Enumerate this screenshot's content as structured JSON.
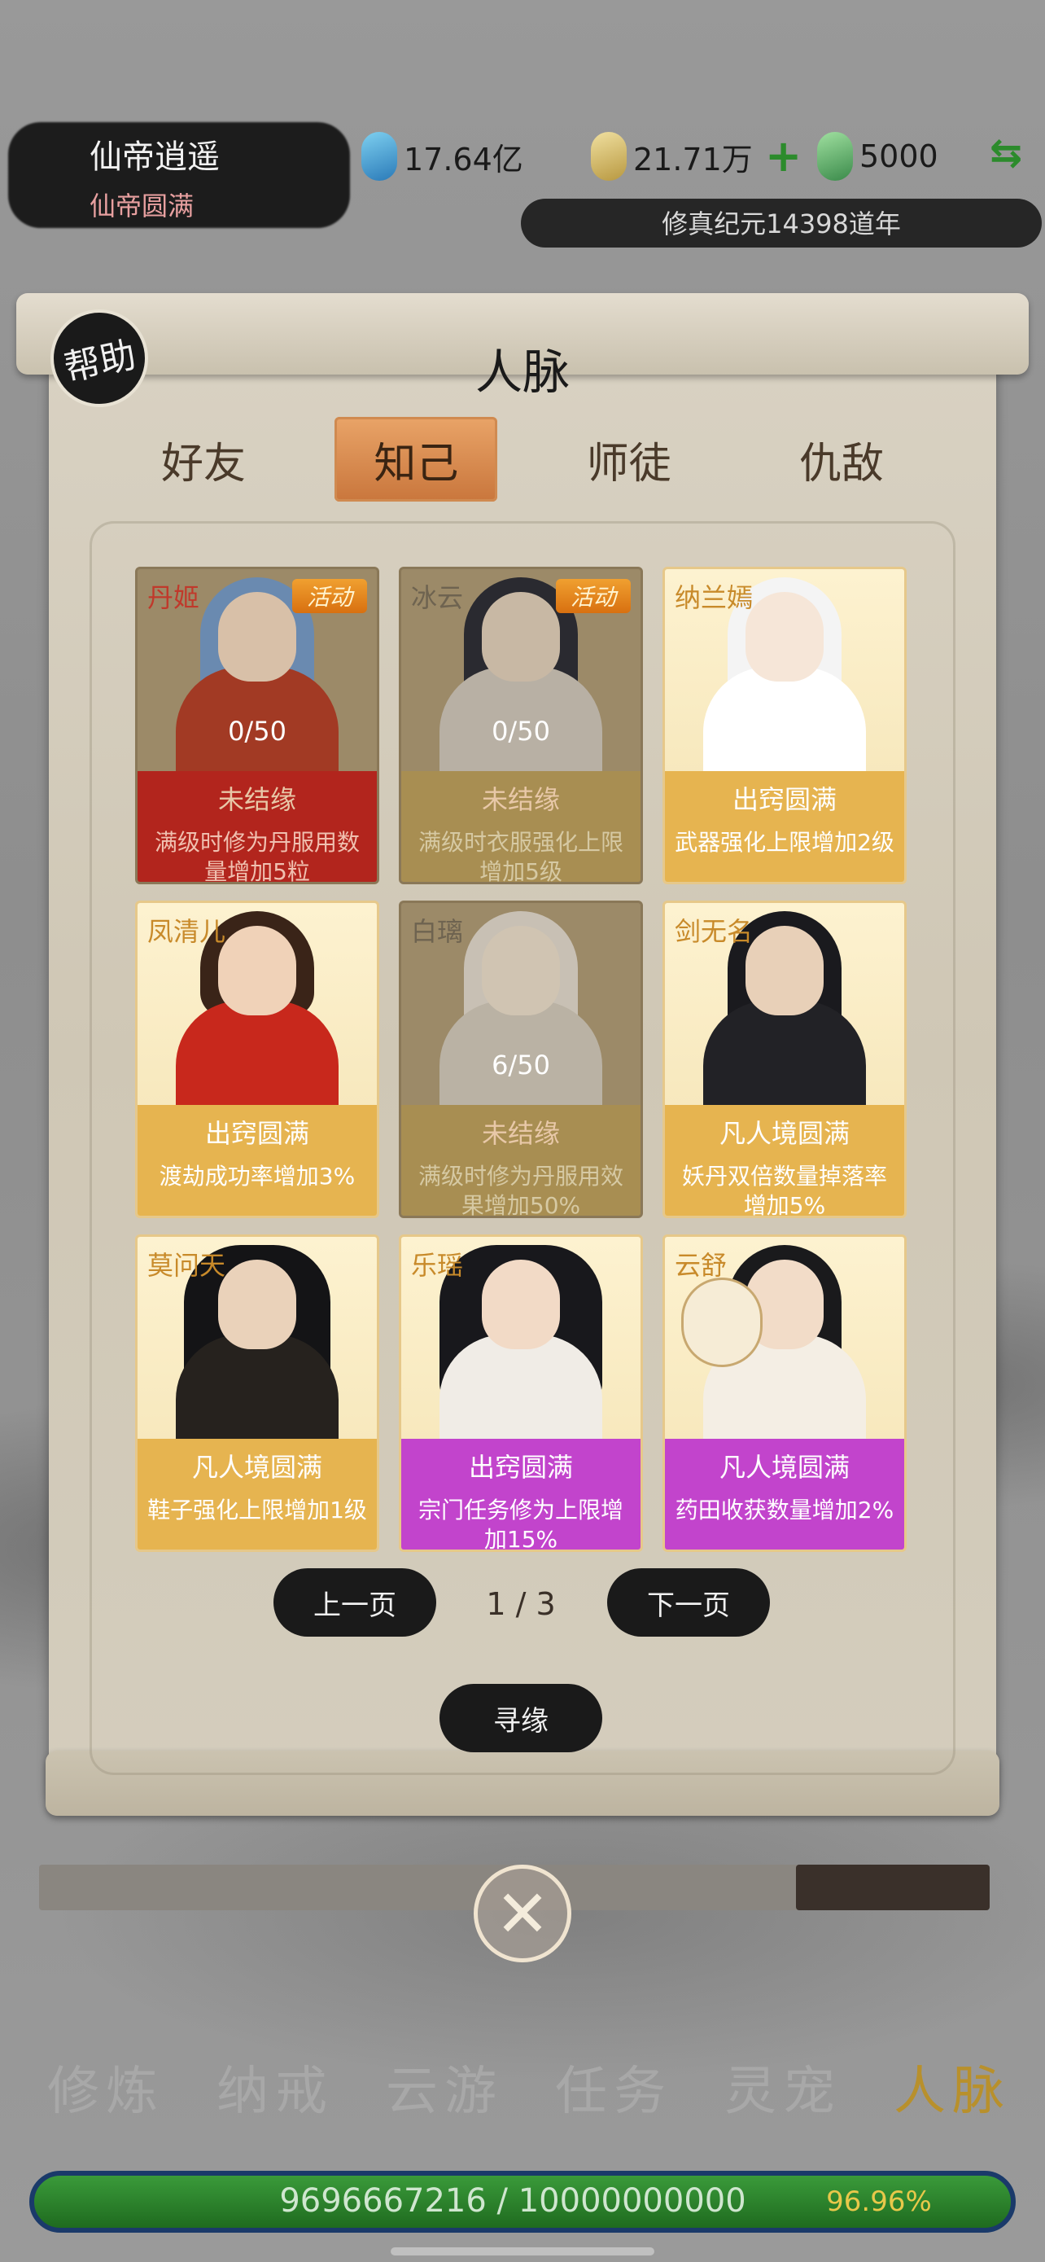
{
  "player": {
    "name": "仙帝逍遥",
    "rank": "仙帝圆满"
  },
  "resources": {
    "spirit_stone": "17.64亿",
    "gold": "21.71万",
    "jade": "5000",
    "plus": "+",
    "swap": "⇆"
  },
  "era": "修真纪元14398道年",
  "help_label": "帮助",
  "panel_title": "人脉",
  "tabs": [
    {
      "label": "好友",
      "active": false
    },
    {
      "label": "知己",
      "active": true
    },
    {
      "label": "师徒",
      "active": false
    },
    {
      "label": "仇敌",
      "active": false
    }
  ],
  "cards": [
    {
      "name": "丹姬",
      "badge": "活动",
      "progress": "0/50",
      "status": "未结缘",
      "effect": "满级时修为丹服用数量增加5粒",
      "style": "red",
      "locked": true
    },
    {
      "name": "冰云",
      "badge": "活动",
      "progress": "0/50",
      "status": "未结缘",
      "effect": "满级时衣服强化上限增加5级",
      "style": "dim",
      "locked": true
    },
    {
      "name": "纳兰嫣",
      "badge": "",
      "progress": "",
      "status": "出窍圆满",
      "effect": "武器强化上限增加2级",
      "style": "gold",
      "locked": false
    },
    {
      "name": "凤清儿",
      "badge": "",
      "progress": "",
      "status": "出窍圆满",
      "effect": "渡劫成功率增加3%",
      "style": "gold",
      "locked": false
    },
    {
      "name": "白璃",
      "badge": "",
      "progress": "6/50",
      "status": "未结缘",
      "effect": "满级时修为丹服用效果增加50%",
      "style": "dim",
      "locked": true
    },
    {
      "name": "剑无名",
      "badge": "",
      "progress": "",
      "status": "凡人境圆满",
      "effect": "妖丹双倍数量掉落率增加5%",
      "style": "gold",
      "locked": false
    },
    {
      "name": "莫问天",
      "badge": "",
      "progress": "",
      "status": "凡人境圆满",
      "effect": "鞋子强化上限增加1级",
      "style": "gold",
      "locked": false
    },
    {
      "name": "乐瑶",
      "badge": "",
      "progress": "",
      "status": "出窍圆满",
      "effect": "宗门任务修为上限增加15%",
      "style": "purple",
      "locked": false
    },
    {
      "name": "云舒",
      "badge": "",
      "progress": "",
      "status": "凡人境圆满",
      "effect": "药田收获数量增加2%",
      "style": "purple",
      "locked": false
    }
  ],
  "pagination": {
    "prev": "上一页",
    "page": "1 / 3",
    "next": "下一页"
  },
  "seek_label": "寻缘",
  "close_icon": "close-icon",
  "nav": [
    {
      "label": "修炼",
      "active": false
    },
    {
      "label": "纳戒",
      "active": false
    },
    {
      "label": "云游",
      "active": false
    },
    {
      "label": "任务",
      "active": false
    },
    {
      "label": "灵宠",
      "active": false
    },
    {
      "label": "人脉",
      "active": true
    }
  ],
  "exp": {
    "text": "9696667216 / 10000000000",
    "percent": "96.96%"
  },
  "colors": {
    "gold_band": "#e6b450",
    "purple_band": "#c244cc",
    "red_band": "#b2251d",
    "tab_active": "#d88a4c",
    "nav_active": "#b8902c"
  }
}
